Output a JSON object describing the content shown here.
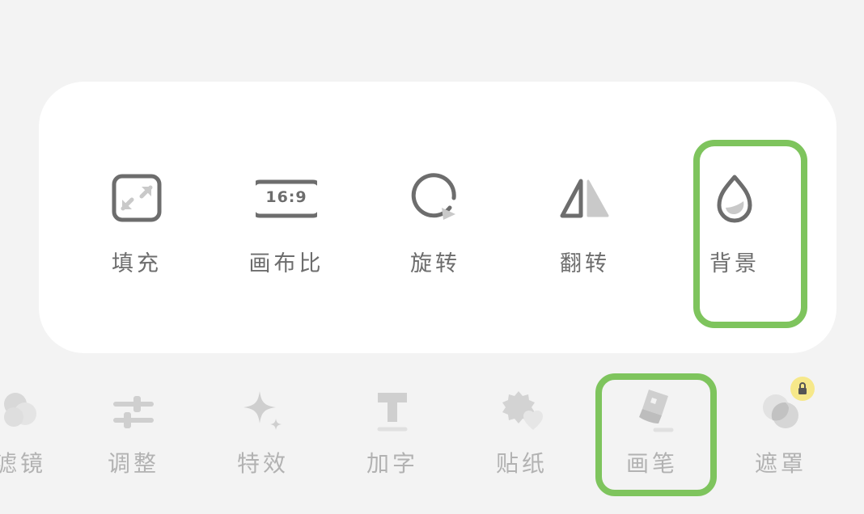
{
  "tools": [
    {
      "id": "fill",
      "label": "填充",
      "icon": "expand-arrows-icon"
    },
    {
      "id": "canvas-ratio",
      "label": "画布比",
      "icon": "aspect-ratio-icon",
      "badge": "16:9"
    },
    {
      "id": "rotate",
      "label": "旋转",
      "icon": "rotate-icon"
    },
    {
      "id": "flip",
      "label": "翻转",
      "icon": "flip-icon"
    },
    {
      "id": "background",
      "label": "背景",
      "icon": "drop-icon",
      "highlighted": true
    }
  ],
  "toolbar": [
    {
      "id": "filter",
      "label": "滤镜",
      "icon": "filter-circles-icon"
    },
    {
      "id": "adjust",
      "label": "调整",
      "icon": "sliders-icon"
    },
    {
      "id": "effects",
      "label": "特效",
      "icon": "sparkle-icon"
    },
    {
      "id": "text",
      "label": "加字",
      "icon": "text-t-icon"
    },
    {
      "id": "sticker",
      "label": "贴纸",
      "icon": "sticker-icon"
    },
    {
      "id": "brush",
      "label": "画笔",
      "icon": "brush-icon",
      "highlighted": true
    },
    {
      "id": "mask",
      "label": "遮罩",
      "icon": "mask-circles-icon",
      "locked": true
    }
  ],
  "colors": {
    "highlight": "#7ec45d",
    "panel": "#ffffff",
    "background": "#f3f3f3",
    "icon_dark": "#6d6d6d",
    "icon_light": "#c9c9c9",
    "lock_badge": "#f6e88a"
  }
}
